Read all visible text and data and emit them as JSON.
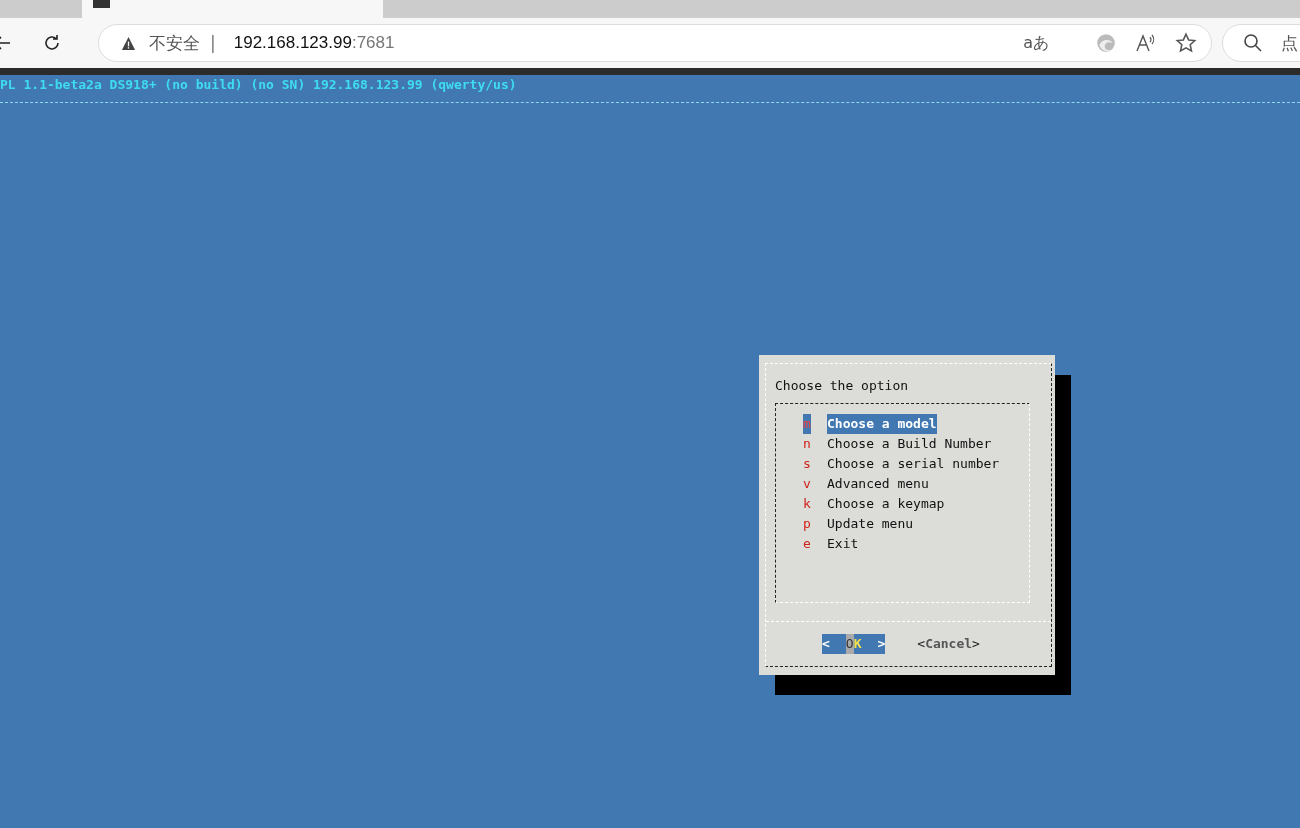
{
  "browser": {
    "security_label": "不安全",
    "separator": "|",
    "url_host": "192.168.123.99",
    "url_port": ":7681",
    "translate_glyph": "aあ",
    "search_text": "点"
  },
  "terminal": {
    "status_line": "PL 1.1-beta2a DS918+ (no build) (no SN) 192.168.123.99 (qwerty/us)"
  },
  "dialog": {
    "title": "Choose the option",
    "items": [
      {
        "key": "m",
        "label": "Choose a model",
        "selected": true
      },
      {
        "key": "n",
        "label": "Choose a Build Number",
        "selected": false
      },
      {
        "key": "s",
        "label": "Choose a serial number",
        "selected": false
      },
      {
        "key": "v",
        "label": "Advanced menu",
        "selected": false
      },
      {
        "key": "k",
        "label": "Choose a keymap",
        "selected": false
      },
      {
        "key": "p",
        "label": "Update menu",
        "selected": false
      },
      {
        "key": "e",
        "label": "Exit",
        "selected": false
      }
    ],
    "buttons": [
      {
        "open": "<",
        "label": "OK",
        "close": ">",
        "selected": true
      },
      {
        "open": "<",
        "label": "Cancel",
        "close": ">",
        "selected": false
      }
    ]
  }
}
